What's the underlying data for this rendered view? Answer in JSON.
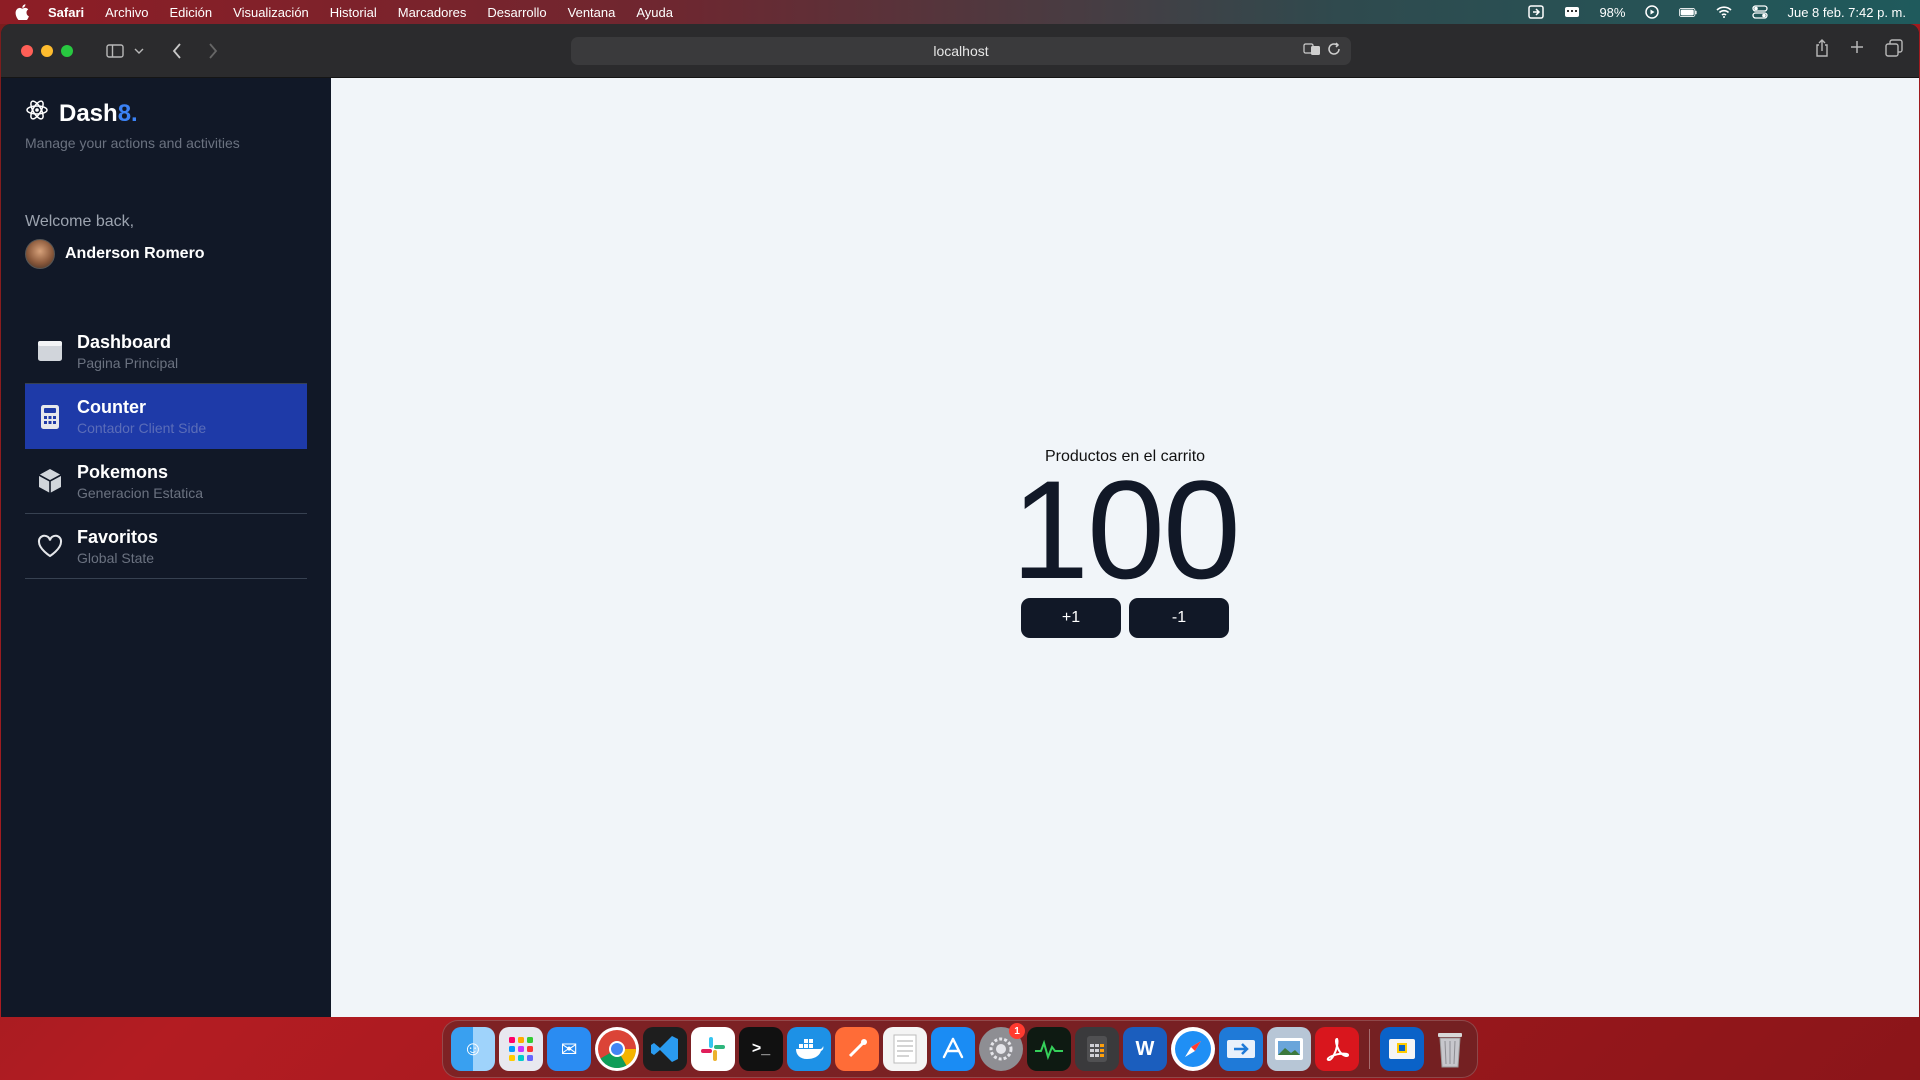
{
  "menubar": {
    "app": "Safari",
    "items": [
      "Archivo",
      "Edición",
      "Visualización",
      "Historial",
      "Marcadores",
      "Desarrollo",
      "Ventana",
      "Ayuda"
    ],
    "battery": "98%",
    "datetime": "Jue 8 feb.  7:42 p. m."
  },
  "browser": {
    "url": "localhost"
  },
  "sidebar": {
    "brand_main": "Dash",
    "brand_accent": "8.",
    "tagline": "Manage your actions and activities",
    "welcome": "Welcome back,",
    "user_name": "Anderson Romero",
    "items": [
      {
        "title": "Dashboard",
        "subtitle": "Pagina Principal",
        "icon": "browser-window-icon"
      },
      {
        "title": "Counter",
        "subtitle": "Contador Client Side",
        "icon": "calculator-icon",
        "active": true
      },
      {
        "title": "Pokemons",
        "subtitle": "Generacion Estatica",
        "icon": "box-icon"
      },
      {
        "title": "Favoritos",
        "subtitle": "Global State",
        "icon": "heart-icon"
      }
    ]
  },
  "counter": {
    "label": "Productos en el carrito",
    "value": "100",
    "increment_label": "+1",
    "decrement_label": "-1"
  },
  "dock": {
    "apps": [
      "Finder",
      "Launchpad",
      "Mail",
      "Chrome",
      "VS Code",
      "Slack",
      "Terminal",
      "Docker",
      "Postman",
      "TextEdit",
      "App Store",
      "System Settings",
      "Activity Monitor",
      "Calculator",
      "Word",
      "Safari",
      "Migration Assistant",
      "Preview",
      "Acrobat",
      "Wallet",
      "Trash"
    ],
    "settings_badge": "1"
  },
  "colors": {
    "sidebar_bg": "#111827",
    "active_item": "#1e3aa8",
    "main_bg": "#f1f5f9",
    "accent": "#3b82f6"
  }
}
